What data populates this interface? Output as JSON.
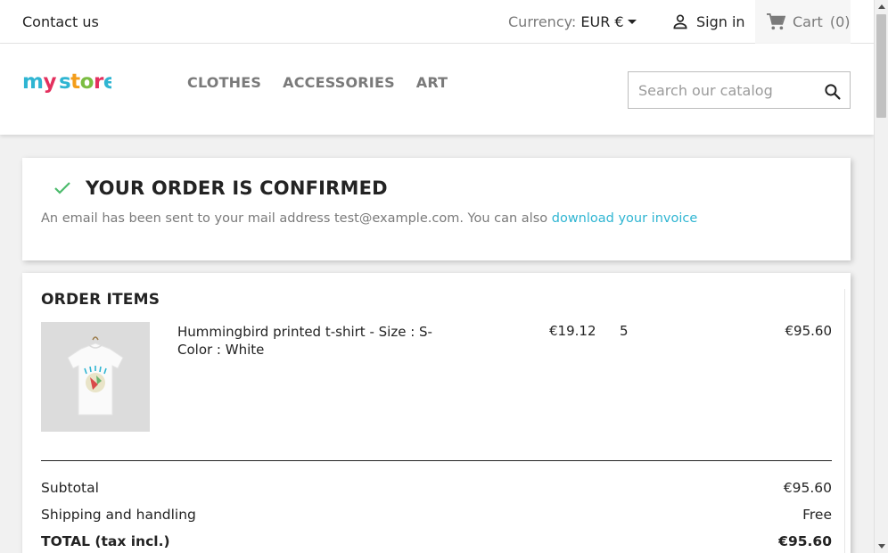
{
  "topbar": {
    "contact_label": "Contact us",
    "currency_label": "Currency:",
    "currency_value": "EUR €",
    "signin_label": "Sign in",
    "cart_label": "Cart",
    "cart_count": "(0)"
  },
  "header": {
    "logo_text": "my store",
    "nav": [
      {
        "label": "CLOTHES"
      },
      {
        "label": "ACCESSORIES"
      },
      {
        "label": "ART"
      }
    ],
    "search_placeholder": "Search our catalog"
  },
  "confirmation": {
    "title": "YOUR ORDER IS CONFIRMED",
    "message": "An email has been sent to your mail address test@example.com. You can also ",
    "invoice_link": "download your invoice"
  },
  "order_items": {
    "title": "ORDER ITEMS",
    "items": [
      {
        "name": "Hummingbird printed t-shirt - Size : S- Color : White",
        "unit_price": "€19.12",
        "quantity": "5",
        "total": "€95.60"
      }
    ],
    "summary": {
      "subtotal_label": "Subtotal",
      "subtotal_value": "€95.60",
      "shipping_label": "Shipping and handling",
      "shipping_value": "Free",
      "total_label": "TOTAL (tax incl.)",
      "total_value": "€95.60"
    }
  },
  "colors": {
    "accent": "#2fb5d2",
    "check": "#4cbb6c",
    "muted_text": "#7a7a7a"
  }
}
